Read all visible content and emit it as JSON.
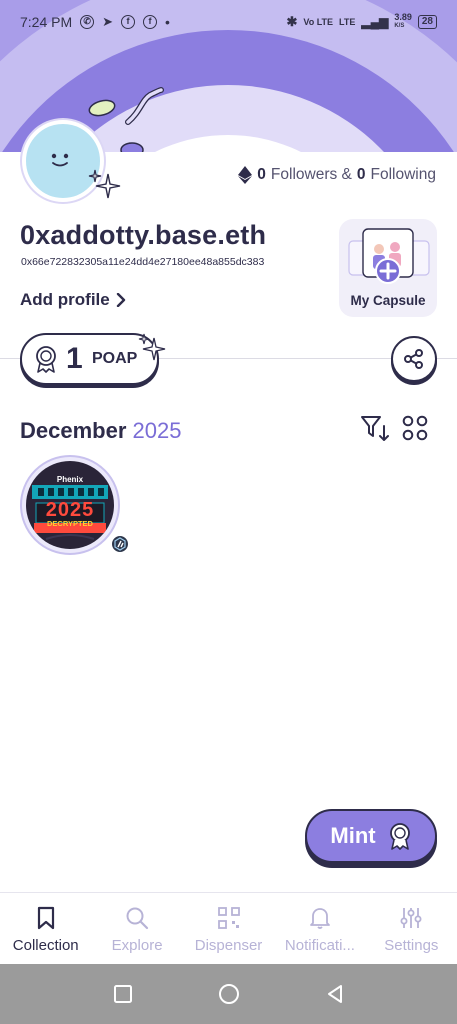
{
  "status_bar": {
    "time": "7:24 PM",
    "network_speed": "3.89",
    "speed_unit": "K/S",
    "network_type": "LTE",
    "volte": "Vo LTE",
    "battery": "28"
  },
  "profile": {
    "followers_count": "0",
    "followers_label": "Followers &",
    "following_count": "0",
    "following_label": "Following",
    "name": "0xaddotty.base.eth",
    "address": "0x66e722832305a11e24dd4e27180ee48a855dc383",
    "add_profile_label": "Add profile"
  },
  "capsule": {
    "label": "My Capsule"
  },
  "poap_summary": {
    "count": "1",
    "label": "POAP"
  },
  "collection": {
    "month": "December",
    "year": "2025",
    "tokens": [
      {
        "brand": "Phenix",
        "year_text": "2025",
        "caption": "DECRYPTED"
      }
    ]
  },
  "mint_button": {
    "label": "Mint"
  },
  "bottom_nav": {
    "items": [
      {
        "label": "Collection",
        "icon": "bookmark-icon",
        "active": true
      },
      {
        "label": "Explore",
        "icon": "search-icon",
        "active": false
      },
      {
        "label": "Dispenser",
        "icon": "qr-code-icon",
        "active": false
      },
      {
        "label": "Notificati...",
        "icon": "bell-icon",
        "active": false
      },
      {
        "label": "Settings",
        "icon": "sliders-icon",
        "active": false
      }
    ]
  },
  "colors": {
    "accent": "#8c7ee0",
    "accent_light": "#b7b3d6",
    "text_dark": "#2e2c4a",
    "avatar_blue": "#b7e2f2"
  }
}
